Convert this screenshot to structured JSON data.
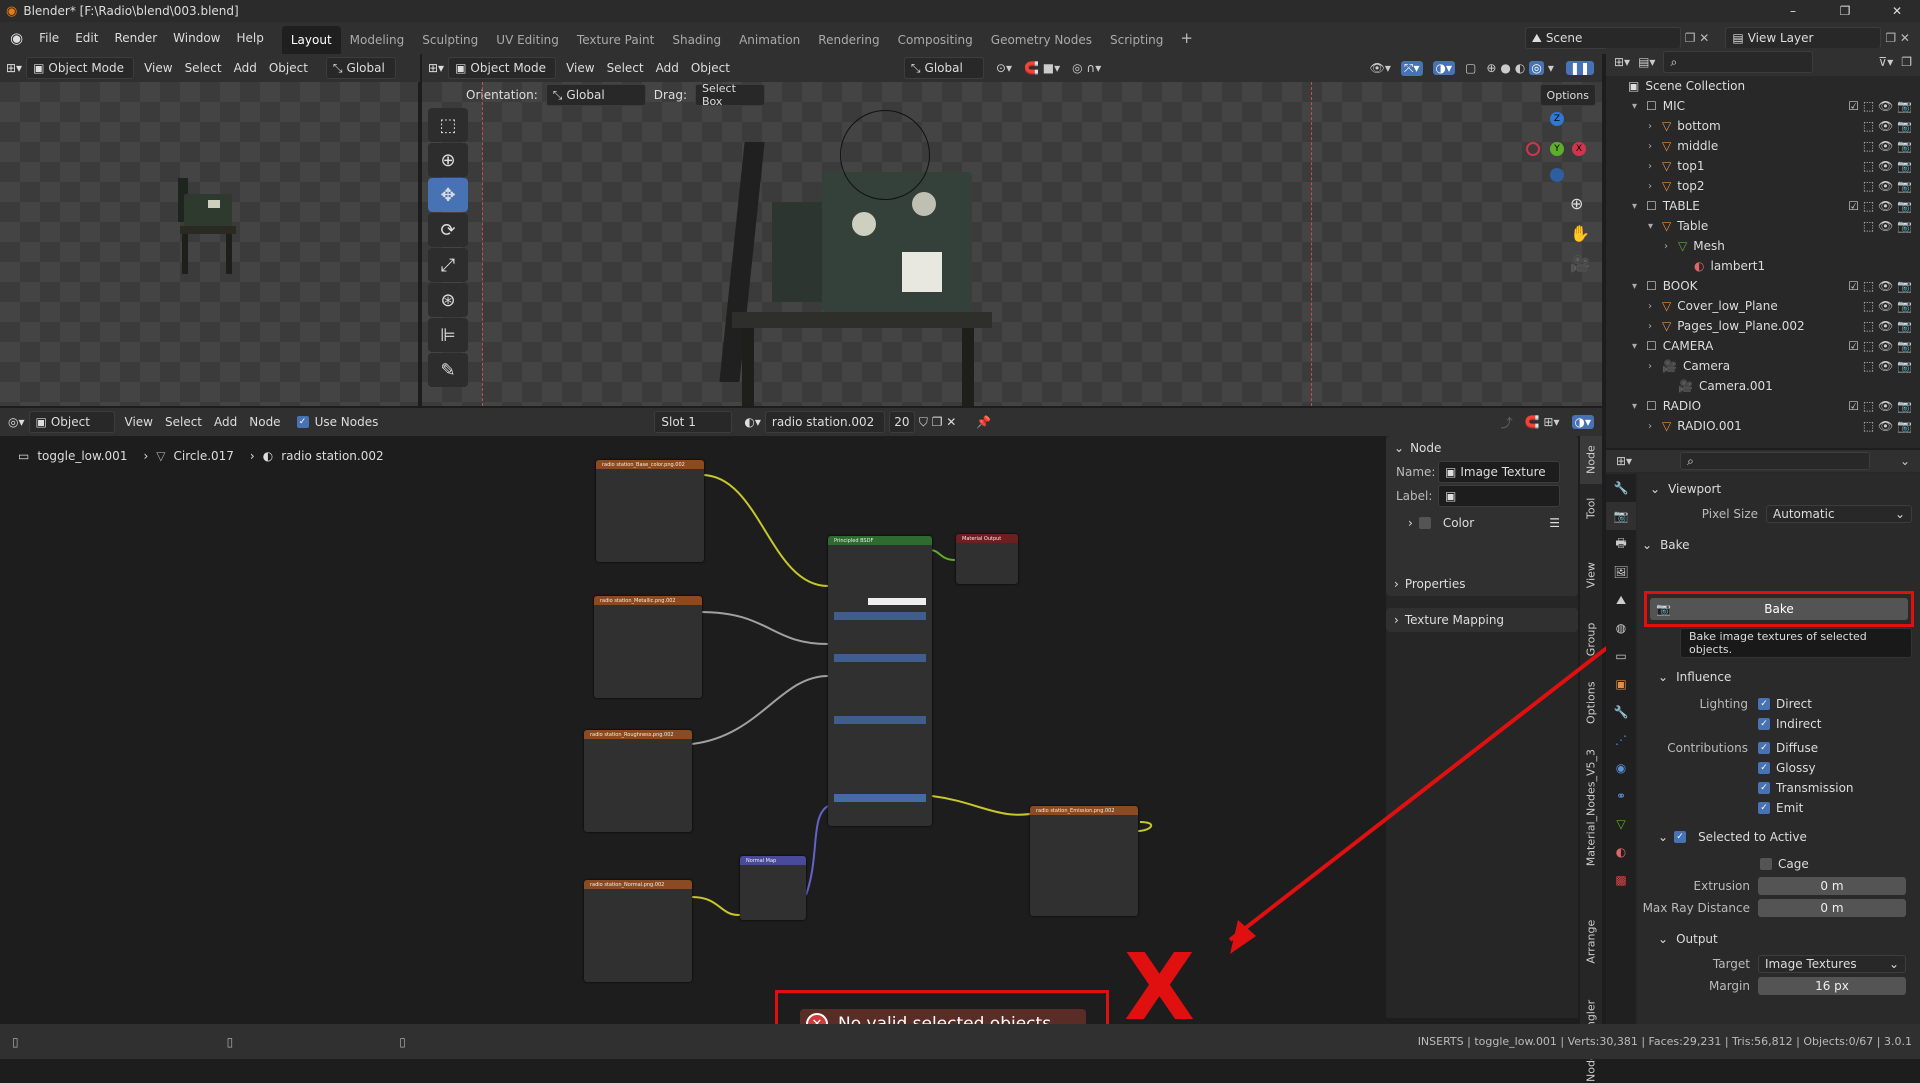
{
  "window": {
    "title": "Blender* [F:\\Radio\\blend\\003.blend]",
    "minimize": "–",
    "maximize": "❐",
    "close": "✕"
  },
  "menu": [
    "File",
    "Edit",
    "Render",
    "Window",
    "Help"
  ],
  "workspaces": [
    "Layout",
    "Modeling",
    "Sculpting",
    "UV Editing",
    "Texture Paint",
    "Shading",
    "Animation",
    "Rendering",
    "Compositing",
    "Geometry Nodes",
    "Scripting"
  ],
  "workspace_add": "+",
  "scene": {
    "scene_name": "Scene",
    "view_layer": "View Layer"
  },
  "left_viewport": {
    "mode": "Object Mode",
    "menus": [
      "View",
      "Select",
      "Add",
      "Object"
    ],
    "orientation": "Global"
  },
  "main_viewport": {
    "mode": "Object Mode",
    "menus": [
      "View",
      "Select",
      "Add",
      "Object"
    ],
    "orientation": "Global",
    "tool_settings": {
      "orientation_label": "Orientation:",
      "orientation_value": "Global",
      "drag_label": "Drag:",
      "drag_value": "Select Box",
      "options": "Options"
    }
  },
  "gizmo": {
    "z": "Z",
    "y": "Y",
    "x": "X"
  },
  "outliner": {
    "title": "Scene Collection",
    "items": [
      {
        "label": "MIC",
        "indent": 0,
        "kind": "collection"
      },
      {
        "label": "bottom",
        "indent": 1,
        "kind": "object"
      },
      {
        "label": "middle",
        "indent": 1,
        "kind": "object"
      },
      {
        "label": "top1",
        "indent": 1,
        "kind": "object"
      },
      {
        "label": "top2",
        "indent": 1,
        "kind": "object"
      },
      {
        "label": "TABLE",
        "indent": 0,
        "kind": "collection"
      },
      {
        "label": "Table",
        "indent": 1,
        "kind": "object"
      },
      {
        "label": "Mesh",
        "indent": 2,
        "kind": "mesh"
      },
      {
        "label": "lambert1",
        "indent": 3,
        "kind": "material"
      },
      {
        "label": "BOOK",
        "indent": 0,
        "kind": "collection"
      },
      {
        "label": "Cover_low_Plane",
        "indent": 1,
        "kind": "object"
      },
      {
        "label": "Pages_low_Plane.002",
        "indent": 1,
        "kind": "object"
      },
      {
        "label": "CAMERA",
        "indent": 0,
        "kind": "collection"
      },
      {
        "label": "Camera",
        "indent": 1,
        "kind": "camera"
      },
      {
        "label": "Camera.001",
        "indent": 2,
        "kind": "cameradata"
      },
      {
        "label": "RADIO",
        "indent": 0,
        "kind": "collection"
      },
      {
        "label": "RADIO.001",
        "indent": 1,
        "kind": "object"
      }
    ]
  },
  "node_editor": {
    "type": "Object",
    "menus": [
      "View",
      "Select",
      "Add",
      "Node"
    ],
    "use_nodes": "Use Nodes",
    "slot": "Slot 1",
    "material": "radio station.002",
    "users": "20",
    "breadcrumb": [
      "toggle_low.001",
      "Circle.017",
      "radio station.002"
    ]
  },
  "node_panel": {
    "section": "Node",
    "name_label": "Name:",
    "name_value": "Image Texture",
    "label_label": "Label:",
    "label_value": "",
    "color": "Color",
    "properties": "Properties",
    "texture_mapping": "Texture Mapping"
  },
  "side_tabs": [
    "Node",
    "Tool",
    "View",
    "Group",
    "Options",
    "Material_Nodes_V5_3",
    "Arrange",
    "Node Wrangler"
  ],
  "nodes": {
    "principled": "Principled BSDF",
    "output": "Material Output",
    "base": "radio station_Base_color.png.002",
    "metal": "radio station_Metallic.png.002",
    "rough": "radio station_Roughness.png.002",
    "normal": "radio station_Normal.png.002",
    "emis": "radio station_Emission.png.002",
    "normalmap": "Normal Map"
  },
  "properties": {
    "viewport": "Viewport",
    "pixel_size_label": "Pixel Size",
    "pixel_size_value": "Automatic",
    "bake": "Bake",
    "bake_button": "Bake",
    "tooltip": "Bake image textures of selected objects.",
    "influence": "Influence",
    "lighting_label": "Lighting",
    "direct": "Direct",
    "indirect": "Indirect",
    "contributions_label": "Contributions",
    "diffuse": "Diffuse",
    "glossy": "Glossy",
    "transmission": "Transmission",
    "emit": "Emit",
    "selected_to_active": "Selected to Active",
    "cage": "Cage",
    "extrusion_label": "Extrusion",
    "extrusion_value": "0 m",
    "max_ray_label": "Max Ray Distance",
    "max_ray_value": "0 m",
    "output": "Output",
    "target_label": "Target",
    "target_value": "Image Textures",
    "margin_label": "Margin",
    "margin_value": "16 px"
  },
  "error": {
    "message": "No valid selected objects"
  },
  "annotation": {
    "mark": "X",
    "color": "#e01010"
  },
  "statusbar": "INSERTS | toggle_low.001 | Verts:30,381 | Faces:29,231 | Tris:56,812 | Objects:0/67 | 3.0.1"
}
